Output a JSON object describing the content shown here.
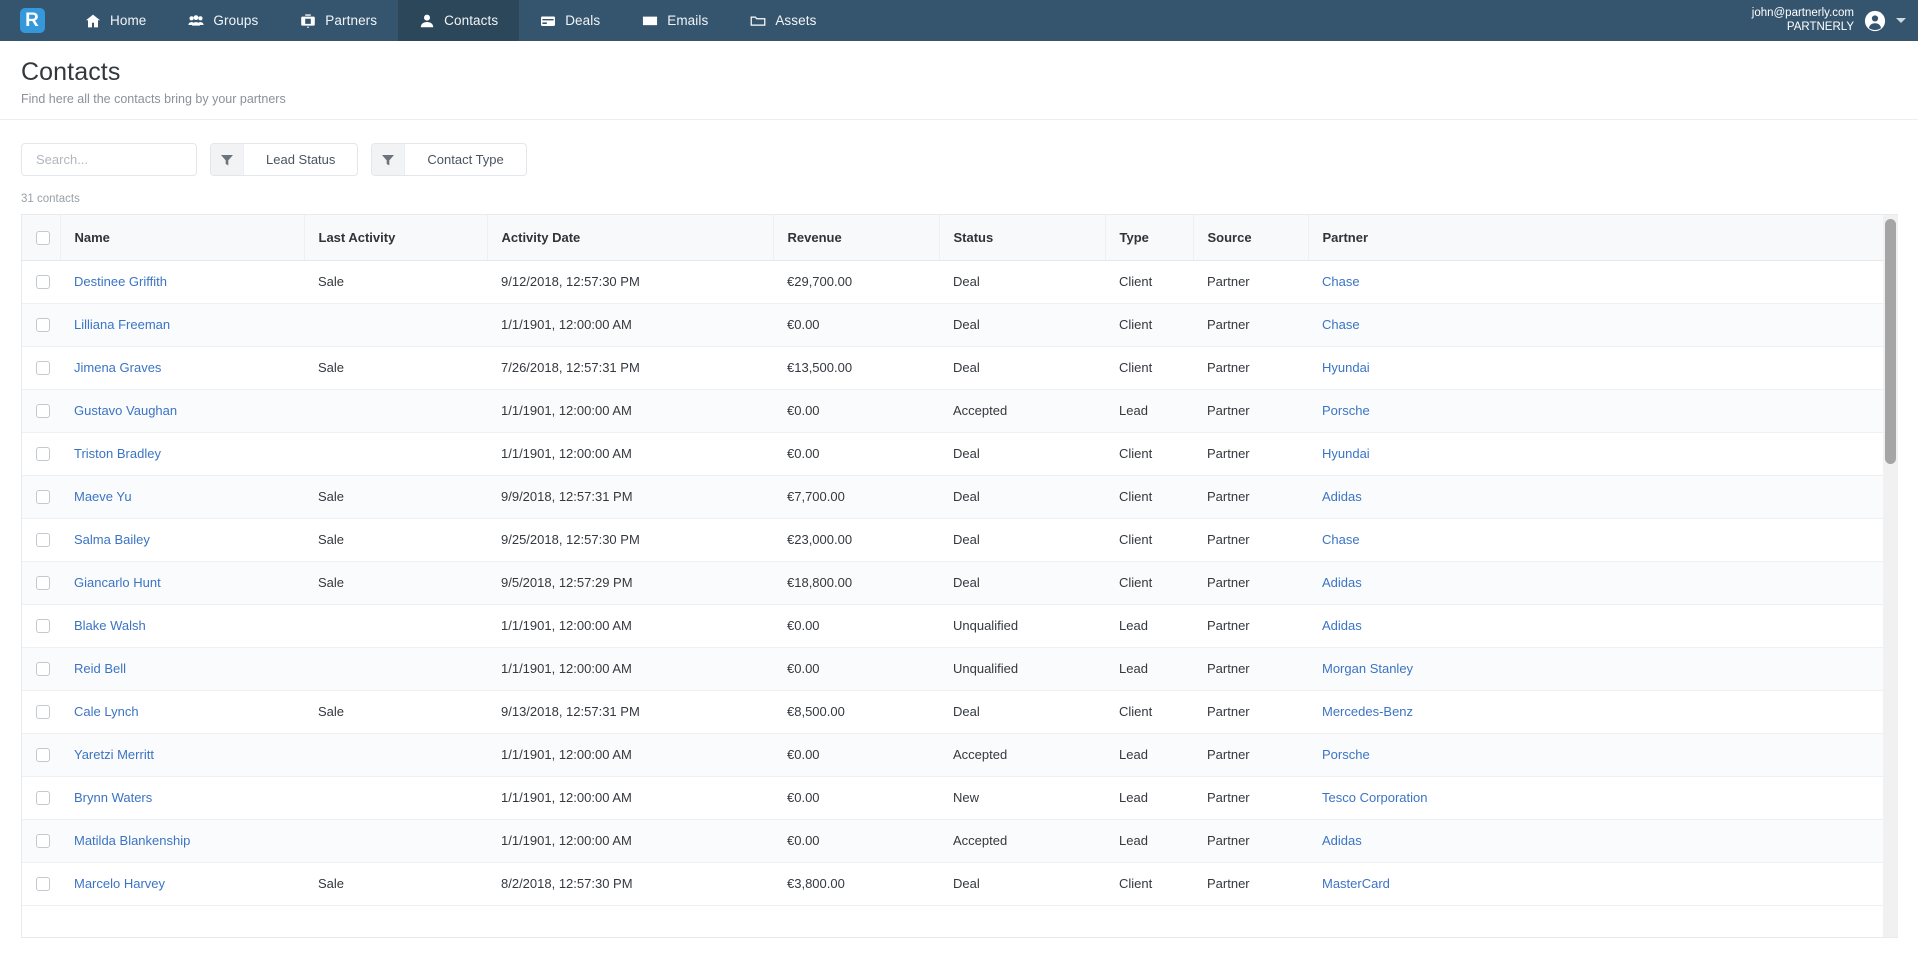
{
  "navbar": {
    "logo_letter": "R",
    "items": [
      {
        "label": "Home",
        "icon": "home-icon",
        "active": false
      },
      {
        "label": "Groups",
        "icon": "groups-icon",
        "active": false
      },
      {
        "label": "Partners",
        "icon": "partners-icon",
        "active": false
      },
      {
        "label": "Contacts",
        "icon": "contact-icon",
        "active": true
      },
      {
        "label": "Deals",
        "icon": "deals-icon",
        "active": false
      },
      {
        "label": "Emails",
        "icon": "envelope-icon",
        "active": false
      },
      {
        "label": "Assets",
        "icon": "folder-icon",
        "active": false
      }
    ],
    "user": {
      "email": "john@partnerly.com",
      "org": "PARTNERLY",
      "avatar_icon": "user-avatar-icon",
      "caret_icon": "chevron-down-icon"
    },
    "background_color": "#35556f",
    "active_color": "#2c4759",
    "logo_color": "#3498db"
  },
  "page": {
    "title": "Contacts",
    "subtitle": "Find here all the contacts bring by your partners"
  },
  "toolbar": {
    "search_placeholder": "Search...",
    "search_value": "",
    "search_icon": "search-icon",
    "filters": [
      {
        "label": "Lead Status",
        "icon": "filter-funnel-icon"
      },
      {
        "label": "Contact Type",
        "icon": "filter-funnel-icon"
      }
    ]
  },
  "count_label": "31 contacts",
  "table": {
    "columns": [
      {
        "key": "checkbox",
        "label": ""
      },
      {
        "key": "name",
        "label": "Name"
      },
      {
        "key": "activity",
        "label": "Last Activity"
      },
      {
        "key": "date",
        "label": "Activity Date"
      },
      {
        "key": "revenue",
        "label": "Revenue"
      },
      {
        "key": "status",
        "label": "Status"
      },
      {
        "key": "type",
        "label": "Type"
      },
      {
        "key": "source",
        "label": "Source"
      },
      {
        "key": "partner",
        "label": "Partner"
      }
    ],
    "link_color": "#3b74c4",
    "rows": [
      {
        "name": "Destinee Griffith",
        "activity": "Sale",
        "date": "9/12/2018, 12:57:30 PM",
        "revenue": "€29,700.00",
        "status": "Deal",
        "type": "Client",
        "source": "Partner",
        "partner": "Chase"
      },
      {
        "name": "Lilliana Freeman",
        "activity": "",
        "date": "1/1/1901, 12:00:00 AM",
        "revenue": "€0.00",
        "status": "Deal",
        "type": "Client",
        "source": "Partner",
        "partner": "Chase"
      },
      {
        "name": "Jimena Graves",
        "activity": "Sale",
        "date": "7/26/2018, 12:57:31 PM",
        "revenue": "€13,500.00",
        "status": "Deal",
        "type": "Client",
        "source": "Partner",
        "partner": "Hyundai"
      },
      {
        "name": "Gustavo Vaughan",
        "activity": "",
        "date": "1/1/1901, 12:00:00 AM",
        "revenue": "€0.00",
        "status": "Accepted",
        "type": "Lead",
        "source": "Partner",
        "partner": "Porsche"
      },
      {
        "name": "Triston Bradley",
        "activity": "",
        "date": "1/1/1901, 12:00:00 AM",
        "revenue": "€0.00",
        "status": "Deal",
        "type": "Client",
        "source": "Partner",
        "partner": "Hyundai"
      },
      {
        "name": "Maeve Yu",
        "activity": "Sale",
        "date": "9/9/2018, 12:57:31 PM",
        "revenue": "€7,700.00",
        "status": "Deal",
        "type": "Client",
        "source": "Partner",
        "partner": "Adidas"
      },
      {
        "name": "Salma Bailey",
        "activity": "Sale",
        "date": "9/25/2018, 12:57:30 PM",
        "revenue": "€23,000.00",
        "status": "Deal",
        "type": "Client",
        "source": "Partner",
        "partner": "Chase"
      },
      {
        "name": "Giancarlo Hunt",
        "activity": "Sale",
        "date": "9/5/2018, 12:57:29 PM",
        "revenue": "€18,800.00",
        "status": "Deal",
        "type": "Client",
        "source": "Partner",
        "partner": "Adidas"
      },
      {
        "name": "Blake Walsh",
        "activity": "",
        "date": "1/1/1901, 12:00:00 AM",
        "revenue": "€0.00",
        "status": "Unqualified",
        "type": "Lead",
        "source": "Partner",
        "partner": "Adidas"
      },
      {
        "name": "Reid Bell",
        "activity": "",
        "date": "1/1/1901, 12:00:00 AM",
        "revenue": "€0.00",
        "status": "Unqualified",
        "type": "Lead",
        "source": "Partner",
        "partner": "Morgan Stanley"
      },
      {
        "name": "Cale Lynch",
        "activity": "Sale",
        "date": "9/13/2018, 12:57:31 PM",
        "revenue": "€8,500.00",
        "status": "Deal",
        "type": "Client",
        "source": "Partner",
        "partner": "Mercedes-Benz"
      },
      {
        "name": "Yaretzi Merritt",
        "activity": "",
        "date": "1/1/1901, 12:00:00 AM",
        "revenue": "€0.00",
        "status": "Accepted",
        "type": "Lead",
        "source": "Partner",
        "partner": "Porsche"
      },
      {
        "name": "Brynn Waters",
        "activity": "",
        "date": "1/1/1901, 12:00:00 AM",
        "revenue": "€0.00",
        "status": "New",
        "type": "Lead",
        "source": "Partner",
        "partner": "Tesco Corporation"
      },
      {
        "name": "Matilda Blankenship",
        "activity": "",
        "date": "1/1/1901, 12:00:00 AM",
        "revenue": "€0.00",
        "status": "Accepted",
        "type": "Lead",
        "source": "Partner",
        "partner": "Adidas"
      },
      {
        "name": "Marcelo Harvey",
        "activity": "Sale",
        "date": "8/2/2018, 12:57:30 PM",
        "revenue": "€3,800.00",
        "status": "Deal",
        "type": "Client",
        "source": "Partner",
        "partner": "MasterCard"
      }
    ]
  },
  "scrollbar": {
    "icon": "vertical-scrollbar"
  }
}
